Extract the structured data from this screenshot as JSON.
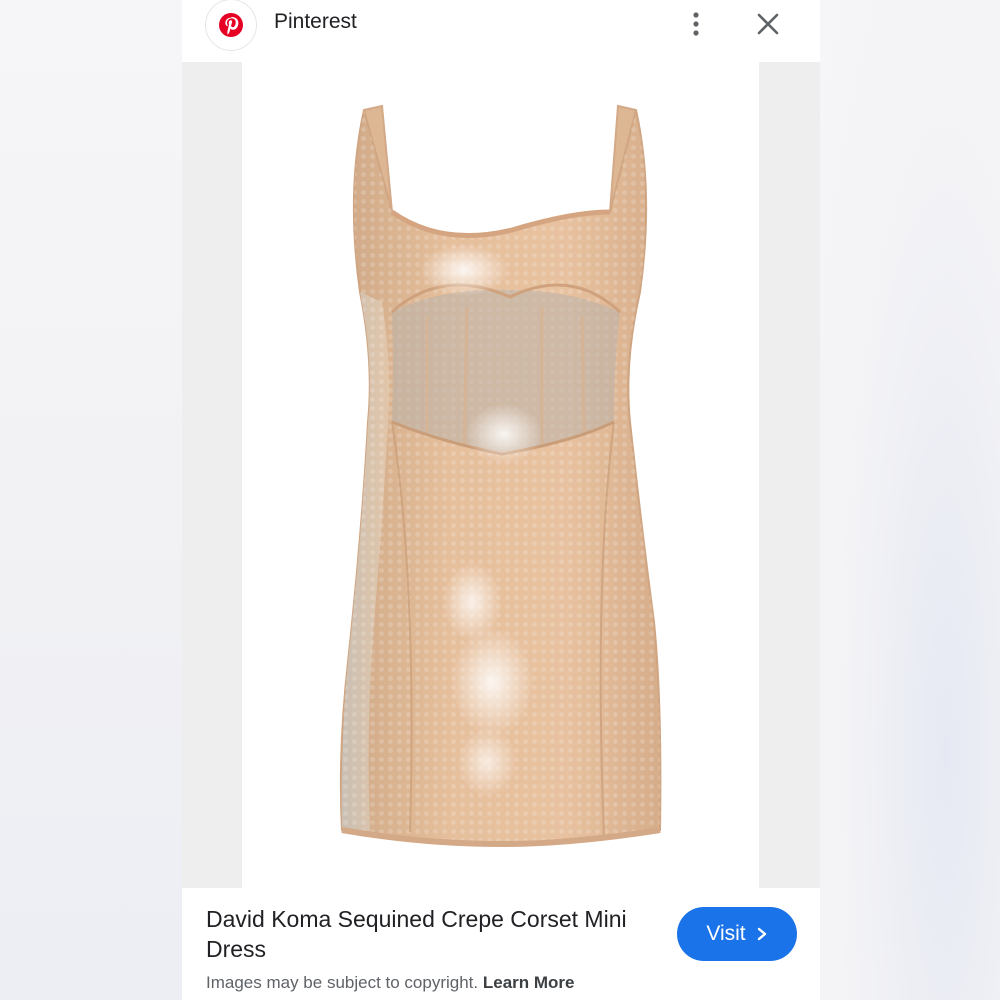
{
  "header": {
    "source_name": "Pinterest",
    "logo_icon": "pinterest-logo-icon",
    "more_icon": "more-vert-icon",
    "close_icon": "close-icon"
  },
  "result": {
    "title": "David Koma Sequined Crepe Corset Mini Dress",
    "visit_label": "Visit",
    "visit_icon": "chevron-right-icon",
    "copyright_text": "Images may be subject to copyright.",
    "learn_more_label": "Learn More"
  },
  "colors": {
    "accent": "#1a73e8",
    "pinterest_red": "#e60023",
    "dress": "#e2b792"
  }
}
